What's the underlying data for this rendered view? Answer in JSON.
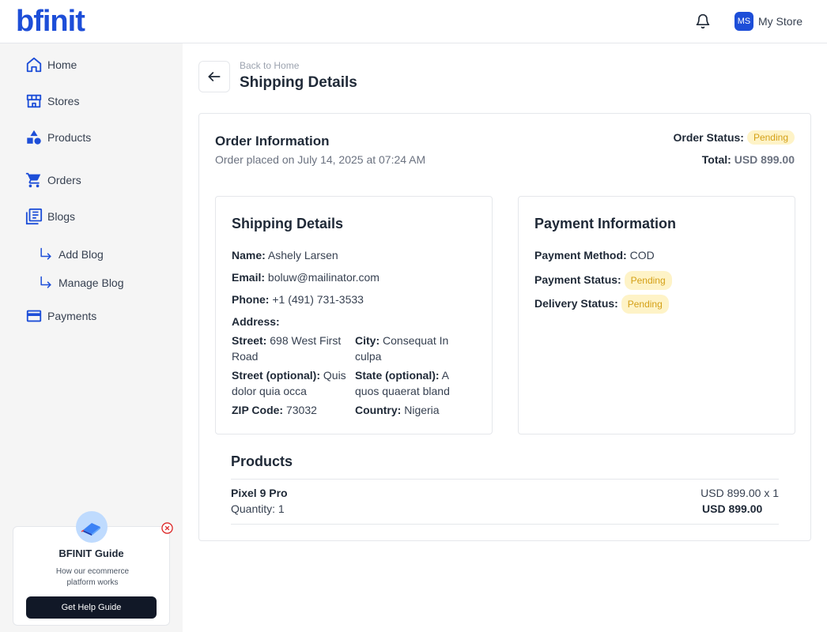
{
  "header": {
    "logo": "bfinit",
    "avatar_initials": "MS",
    "store_name": "My Store"
  },
  "sidebar": {
    "items": [
      {
        "label": "Home",
        "icon": "home-icon"
      },
      {
        "label": "Stores",
        "icon": "store-icon"
      },
      {
        "label": "Products",
        "icon": "products-icon"
      },
      {
        "label": "Orders",
        "icon": "cart-icon"
      },
      {
        "label": "Blogs",
        "icon": "blog-icon"
      },
      {
        "label": "Payments",
        "icon": "credit-card-icon"
      }
    ],
    "blog_sub_items": [
      {
        "label": "Add Blog"
      },
      {
        "label": "Manage Blog"
      }
    ],
    "guide": {
      "title": "BFINIT Guide",
      "description": "How our ecommerce platform works",
      "button": "Get Help Guide"
    }
  },
  "page": {
    "breadcrumb": "Back to Home",
    "title": "Shipping Details"
  },
  "order": {
    "title": "Order Information",
    "placed_on": "Order placed on July 14, 2025 at 07:24 AM",
    "status_label": "Order Status:",
    "status": "Pending",
    "total_label": "Total:",
    "total": "USD 899.00"
  },
  "shipping": {
    "title": "Shipping Details",
    "name_label": "Name:",
    "name": "Ashely Larsen",
    "email_label": "Email:",
    "email": "boluw@mailinator.com",
    "phone_label": "Phone:",
    "phone": "+1 (491) 731-3533",
    "address_label": "Address:",
    "street_label": "Street:",
    "street": "698 West First Road",
    "city_label": "City:",
    "city": "Consequat In culpa",
    "street_opt_label": "Street (optional):",
    "street_opt": "Quis dolor quia occa",
    "state_label": "State (optional):",
    "state": "A quos quaerat bland",
    "zip_label": "ZIP Code:",
    "zip": "73032",
    "country_label": "Country:",
    "country": "Nigeria"
  },
  "payment": {
    "title": "Payment Information",
    "method_label": "Payment Method:",
    "method": "COD",
    "status_label": "Payment Status:",
    "status": "Pending",
    "delivery_label": "Delivery Status:",
    "delivery": "Pending"
  },
  "products": {
    "title": "Products",
    "items": [
      {
        "name": "Pixel 9 Pro",
        "quantity": "Quantity: 1",
        "unit_price": "USD 899.00 x 1",
        "line_total": "USD 899.00"
      }
    ]
  },
  "colors": {
    "brand": "#1d4ed8",
    "pending_bg": "#fef3c7",
    "pending_text": "#d4a017"
  }
}
